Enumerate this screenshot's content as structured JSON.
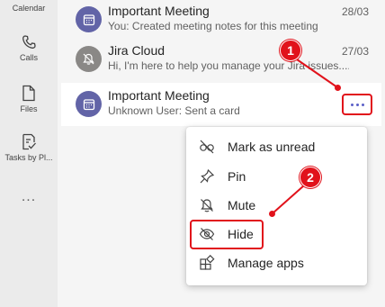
{
  "rail": {
    "items": [
      {
        "label": "Calendar",
        "icon": "calendar-icon"
      },
      {
        "label": "Calls",
        "icon": "phone-icon"
      },
      {
        "label": "Files",
        "icon": "file-icon"
      },
      {
        "label": "Tasks by Pl...",
        "icon": "tasks-icon"
      }
    ],
    "more": "..."
  },
  "chats": [
    {
      "title": "Important Meeting",
      "subtitle": "You: Created meeting notes for this meeting",
      "date": "28/03",
      "icon": "calendar-icon"
    },
    {
      "title": "Jira Cloud",
      "subtitle": "Hi, I'm here to help you manage your Jira issues....",
      "date": "27/03",
      "icon": "bell-off-icon"
    },
    {
      "title": "Important Meeting",
      "subtitle": "Unknown User: Sent a card",
      "date": "",
      "icon": "calendar-icon"
    }
  ],
  "menu": {
    "items": [
      {
        "label": "Mark as unread",
        "icon": "eye-glasses-off-icon"
      },
      {
        "label": "Pin",
        "icon": "pin-icon"
      },
      {
        "label": "Mute",
        "icon": "bell-off-icon"
      },
      {
        "label": "Hide",
        "icon": "eye-off-icon"
      },
      {
        "label": "Manage apps",
        "icon": "apps-icon"
      }
    ]
  },
  "annotations": {
    "step1": "1",
    "step2": "2",
    "color": "#e1121b"
  },
  "colors": {
    "accent": "#5b5fc7",
    "avatar_purple": "#6264a7",
    "avatar_grey": "#8a8886"
  }
}
